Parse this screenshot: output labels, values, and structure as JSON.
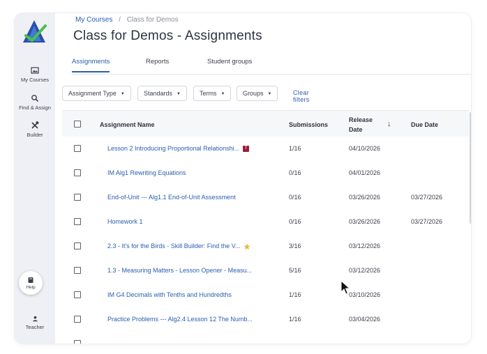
{
  "sidebar": {
    "items": [
      {
        "label": "My Courses",
        "icon": "image-icon"
      },
      {
        "label": "Find & Assign",
        "icon": "search-icon"
      },
      {
        "label": "Builder",
        "icon": "tools-icon"
      }
    ],
    "help_label": "Help",
    "teacher_label": "Teacher"
  },
  "breadcrumb": {
    "parent": "My Courses",
    "separator": "/",
    "current": "Class for Demos"
  },
  "page_title": "Class for Demos - Assignments",
  "tabs": [
    {
      "label": "Assignments",
      "active": true
    },
    {
      "label": "Reports",
      "active": false
    },
    {
      "label": "Student groups",
      "active": false
    }
  ],
  "filters": [
    {
      "label": "Assignment Type"
    },
    {
      "label": "Standards"
    },
    {
      "label": "Terms"
    },
    {
      "label": "Groups"
    }
  ],
  "clear_filters_label": "Clear filters",
  "table": {
    "headers": {
      "name": "Assignment Name",
      "submissions": "Submissions",
      "release_date_line1": "Release",
      "release_date_line2": "Date",
      "sort_indicator": "↓",
      "due_date": "Due Date"
    },
    "rows": [
      {
        "name": "Lesson 2 Introducing Proportional Relationshi...",
        "badge": "T",
        "submissions": "1/16",
        "release": "04/10/2026",
        "due": ""
      },
      {
        "name": "IM Alg1 Rewriting Equations",
        "submissions": "0/16",
        "release": "04/01/2026",
        "due": ""
      },
      {
        "name": "End-of-Unit --- Alg1.1 End-of-Unit Assessment",
        "submissions": "0/16",
        "release": "03/26/2026",
        "due": "03/27/2026"
      },
      {
        "name": "Homework 1",
        "submissions": "0/16",
        "release": "03/26/2026",
        "due": "03/27/2026"
      },
      {
        "name": "2.3 - It's for the Birds - Skill Builder: Find the V...",
        "star": true,
        "submissions": "3/16",
        "release": "03/12/2026",
        "due": ""
      },
      {
        "name": "1.3 - Measuring Matters - Lesson Opener - Measu...",
        "submissions": "5/16",
        "release": "03/12/2026",
        "due": ""
      },
      {
        "name": "IM G4 Decimals with Tenths and Hundredths",
        "submissions": "1/16",
        "release": "03/10/2026",
        "due": ""
      },
      {
        "name": "Practice Problems --- Alg2.4 Lesson 12 The Numb...",
        "submissions": "1/16",
        "release": "03/04/2026",
        "due": ""
      }
    ]
  },
  "colors": {
    "accent": "#2a5db0",
    "badge": "#9b1c3a",
    "star": "#e8b931",
    "sidebar_bg": "#eef0f6"
  }
}
